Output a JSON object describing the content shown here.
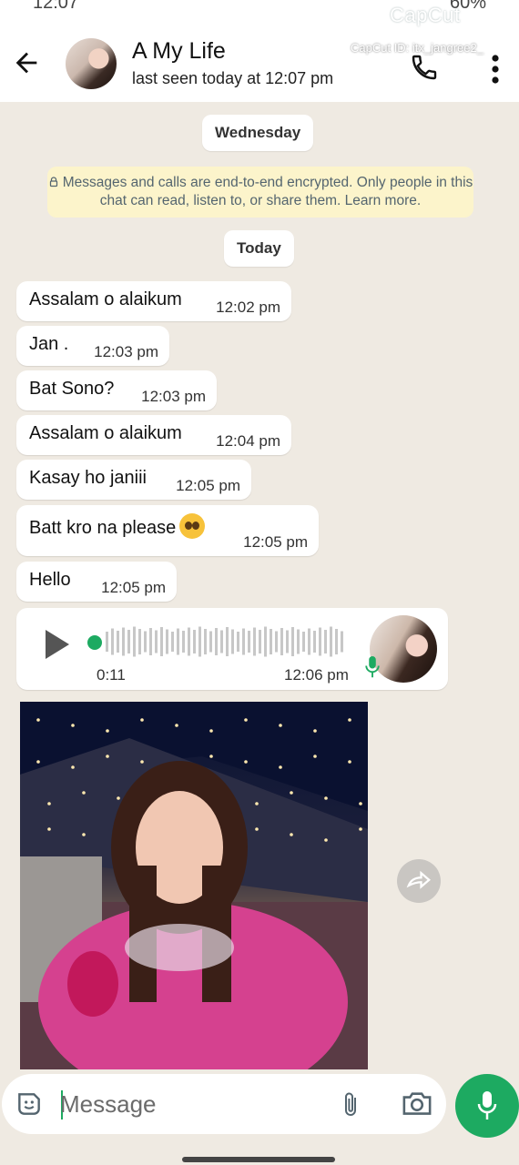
{
  "status_bar": {
    "time": "12:07",
    "battery": "60%"
  },
  "watermark": {
    "brand": "CapCut",
    "id_text": "CapCut ID: itx_jangree2_"
  },
  "header": {
    "contact_name": "A My Life",
    "last_seen": "last seen today at 12:07 pm"
  },
  "date_chips": {
    "first": "Wednesday",
    "second": "Today"
  },
  "encryption_notice": "Messages and calls are end-to-end encrypted. Only people in this chat can read, listen to, or share them. Learn more.",
  "messages": [
    {
      "text": "Assalam o alaikum",
      "time": "12:02 pm"
    },
    {
      "text": "Jan .",
      "time": "12:03 pm"
    },
    {
      "text": "Bat Sono?",
      "time": "12:03 pm"
    },
    {
      "text": "Assalam o alaikum",
      "time": "12:04 pm"
    },
    {
      "text": "Kasay ho janiii",
      "time": "12:05 pm"
    },
    {
      "text": "Batt kro na please",
      "time": "12:05 pm"
    },
    {
      "text": "Hello",
      "time": "12:05 pm"
    }
  ],
  "voice_note": {
    "duration": "0:11",
    "time": "12:06 pm"
  },
  "composer": {
    "placeholder": "Message"
  },
  "colors": {
    "accent": "#1daa61",
    "chat_bg": "#efeae2",
    "notice_bg": "#fcf4cb"
  },
  "icons": [
    "back-arrow-icon",
    "phone-icon",
    "more-vert-icon",
    "lock-icon",
    "play-icon",
    "mic-icon",
    "forward-icon",
    "sticker-icon",
    "paperclip-icon",
    "camera-icon"
  ]
}
